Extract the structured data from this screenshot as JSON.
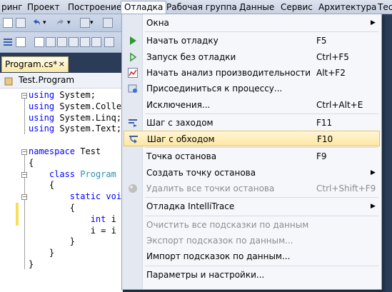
{
  "menubar": {
    "items": [
      "ринг",
      "Проект",
      "Построение",
      "Отладка",
      "Рабочая группа",
      "Данные",
      "Сервис",
      "Архитектура",
      "Тес"
    ],
    "active": "Отладка"
  },
  "tab": {
    "label": "Program.cs*",
    "close": "×"
  },
  "navbar": {
    "text": "Test.Program"
  },
  "code": {
    "lines": [
      [
        {
          "t": "using",
          "c": "kw"
        },
        {
          "t": " System;"
        }
      ],
      [
        {
          "t": "using",
          "c": "kw"
        },
        {
          "t": " System.Colle"
        }
      ],
      [
        {
          "t": "using",
          "c": "kw"
        },
        {
          "t": " System.Linq;"
        }
      ],
      [
        {
          "t": "using",
          "c": "kw"
        },
        {
          "t": " System.Text;"
        }
      ],
      [],
      [
        {
          "t": "namespace",
          "c": "kw"
        },
        {
          "t": " Test"
        }
      ],
      [
        {
          "t": "{"
        }
      ],
      [
        {
          "t": "    "
        },
        {
          "t": "class",
          "c": "kw"
        },
        {
          "t": " "
        },
        {
          "t": "Program",
          "c": "ty"
        }
      ],
      [
        {
          "t": "    {"
        }
      ],
      [
        {
          "t": "        "
        },
        {
          "t": "static",
          "c": "kw"
        },
        {
          "t": " "
        },
        {
          "t": "voi",
          "c": "kw"
        }
      ],
      [
        {
          "t": "        {"
        }
      ],
      [
        {
          "t": "            "
        },
        {
          "t": "int",
          "c": "kw"
        },
        {
          "t": " i"
        }
      ],
      [
        {
          "t": "            i = i"
        }
      ],
      [
        {
          "t": "        }"
        }
      ],
      [
        {
          "t": "    }"
        }
      ],
      [
        {
          "t": "}"
        }
      ]
    ]
  },
  "menu": {
    "items": [
      {
        "label": "Окна",
        "shortcut": "",
        "submenu": true,
        "icon": "",
        "disabled": false
      },
      {
        "sep": true
      },
      {
        "label": "Начать отладку",
        "shortcut": "F5",
        "submenu": false,
        "icon": "start-debug-icon",
        "disabled": false
      },
      {
        "label": "Запуск без отладки",
        "shortcut": "Ctrl+F5",
        "submenu": false,
        "icon": "run-without-debug-icon",
        "disabled": false
      },
      {
        "label": "Начать анализ производительности",
        "shortcut": "Alt+F2",
        "submenu": false,
        "icon": "performance-icon",
        "disabled": false
      },
      {
        "label": "Присоединиться к процессу...",
        "shortcut": "",
        "submenu": false,
        "icon": "attach-process-icon",
        "disabled": false
      },
      {
        "label": "Исключения...",
        "shortcut": "Ctrl+Alt+E",
        "submenu": false,
        "icon": "",
        "disabled": false
      },
      {
        "sep": true
      },
      {
        "label": "Шаг с заходом",
        "shortcut": "F11",
        "submenu": false,
        "icon": "step-into-icon",
        "disabled": false
      },
      {
        "label": "Шаг с обходом",
        "shortcut": "F10",
        "submenu": false,
        "icon": "step-over-icon",
        "disabled": false,
        "highlighted": true
      },
      {
        "sep": true
      },
      {
        "label": "Точка останова",
        "shortcut": "F9",
        "submenu": false,
        "icon": "",
        "disabled": false
      },
      {
        "label": "Создать точку останова",
        "shortcut": "",
        "submenu": true,
        "icon": "",
        "disabled": false
      },
      {
        "label": "Удалить все точки останова",
        "shortcut": "Ctrl+Shift+F9",
        "submenu": false,
        "icon": "delete-breakpoints-icon",
        "disabled": true
      },
      {
        "sep": true
      },
      {
        "label": "Отладка IntelliTrace",
        "shortcut": "",
        "submenu": true,
        "icon": "",
        "disabled": false
      },
      {
        "sep": true
      },
      {
        "label": "Очистить все подсказки по данным",
        "shortcut": "",
        "submenu": false,
        "icon": "",
        "disabled": true
      },
      {
        "label": "Экспорт подсказок по данным...",
        "shortcut": "",
        "submenu": false,
        "icon": "",
        "disabled": true
      },
      {
        "label": "Импорт подсказок по данным...",
        "shortcut": "",
        "submenu": false,
        "icon": "",
        "disabled": false
      },
      {
        "sep": true
      },
      {
        "label": "Параметры и настройки...",
        "shortcut": "",
        "submenu": false,
        "icon": "",
        "disabled": false
      }
    ]
  },
  "colors": {
    "highlight_bg": "#ffe7a2",
    "highlight_border": "#e5c365",
    "keyword": "#0000ff",
    "type": "#2b91af",
    "background": "#2b3c59"
  }
}
